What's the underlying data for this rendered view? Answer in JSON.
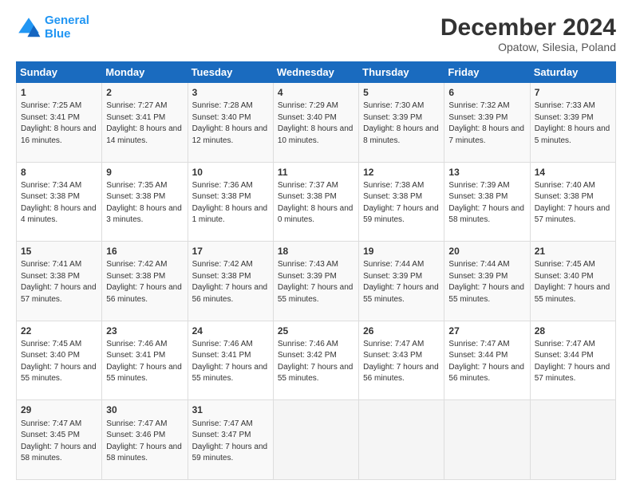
{
  "header": {
    "logo_line1": "General",
    "logo_line2": "Blue",
    "title": "December 2024",
    "subtitle": "Opatow, Silesia, Poland"
  },
  "weekdays": [
    "Sunday",
    "Monday",
    "Tuesday",
    "Wednesday",
    "Thursday",
    "Friday",
    "Saturday"
  ],
  "weeks": [
    [
      {
        "day": "1",
        "sunrise": "7:25 AM",
        "sunset": "3:41 PM",
        "daylight": "8 hours and 16 minutes."
      },
      {
        "day": "2",
        "sunrise": "7:27 AM",
        "sunset": "3:41 PM",
        "daylight": "8 hours and 14 minutes."
      },
      {
        "day": "3",
        "sunrise": "7:28 AM",
        "sunset": "3:40 PM",
        "daylight": "8 hours and 12 minutes."
      },
      {
        "day": "4",
        "sunrise": "7:29 AM",
        "sunset": "3:40 PM",
        "daylight": "8 hours and 10 minutes."
      },
      {
        "day": "5",
        "sunrise": "7:30 AM",
        "sunset": "3:39 PM",
        "daylight": "8 hours and 8 minutes."
      },
      {
        "day": "6",
        "sunrise": "7:32 AM",
        "sunset": "3:39 PM",
        "daylight": "8 hours and 7 minutes."
      },
      {
        "day": "7",
        "sunrise": "7:33 AM",
        "sunset": "3:39 PM",
        "daylight": "8 hours and 5 minutes."
      }
    ],
    [
      {
        "day": "8",
        "sunrise": "7:34 AM",
        "sunset": "3:38 PM",
        "daylight": "8 hours and 4 minutes."
      },
      {
        "day": "9",
        "sunrise": "7:35 AM",
        "sunset": "3:38 PM",
        "daylight": "8 hours and 3 minutes."
      },
      {
        "day": "10",
        "sunrise": "7:36 AM",
        "sunset": "3:38 PM",
        "daylight": "8 hours and 1 minute."
      },
      {
        "day": "11",
        "sunrise": "7:37 AM",
        "sunset": "3:38 PM",
        "daylight": "8 hours and 0 minutes."
      },
      {
        "day": "12",
        "sunrise": "7:38 AM",
        "sunset": "3:38 PM",
        "daylight": "7 hours and 59 minutes."
      },
      {
        "day": "13",
        "sunrise": "7:39 AM",
        "sunset": "3:38 PM",
        "daylight": "7 hours and 58 minutes."
      },
      {
        "day": "14",
        "sunrise": "7:40 AM",
        "sunset": "3:38 PM",
        "daylight": "7 hours and 57 minutes."
      }
    ],
    [
      {
        "day": "15",
        "sunrise": "7:41 AM",
        "sunset": "3:38 PM",
        "daylight": "7 hours and 57 minutes."
      },
      {
        "day": "16",
        "sunrise": "7:42 AM",
        "sunset": "3:38 PM",
        "daylight": "7 hours and 56 minutes."
      },
      {
        "day": "17",
        "sunrise": "7:42 AM",
        "sunset": "3:38 PM",
        "daylight": "7 hours and 56 minutes."
      },
      {
        "day": "18",
        "sunrise": "7:43 AM",
        "sunset": "3:39 PM",
        "daylight": "7 hours and 55 minutes."
      },
      {
        "day": "19",
        "sunrise": "7:44 AM",
        "sunset": "3:39 PM",
        "daylight": "7 hours and 55 minutes."
      },
      {
        "day": "20",
        "sunrise": "7:44 AM",
        "sunset": "3:39 PM",
        "daylight": "7 hours and 55 minutes."
      },
      {
        "day": "21",
        "sunrise": "7:45 AM",
        "sunset": "3:40 PM",
        "daylight": "7 hours and 55 minutes."
      }
    ],
    [
      {
        "day": "22",
        "sunrise": "7:45 AM",
        "sunset": "3:40 PM",
        "daylight": "7 hours and 55 minutes."
      },
      {
        "day": "23",
        "sunrise": "7:46 AM",
        "sunset": "3:41 PM",
        "daylight": "7 hours and 55 minutes."
      },
      {
        "day": "24",
        "sunrise": "7:46 AM",
        "sunset": "3:41 PM",
        "daylight": "7 hours and 55 minutes."
      },
      {
        "day": "25",
        "sunrise": "7:46 AM",
        "sunset": "3:42 PM",
        "daylight": "7 hours and 55 minutes."
      },
      {
        "day": "26",
        "sunrise": "7:47 AM",
        "sunset": "3:43 PM",
        "daylight": "7 hours and 56 minutes."
      },
      {
        "day": "27",
        "sunrise": "7:47 AM",
        "sunset": "3:44 PM",
        "daylight": "7 hours and 56 minutes."
      },
      {
        "day": "28",
        "sunrise": "7:47 AM",
        "sunset": "3:44 PM",
        "daylight": "7 hours and 57 minutes."
      }
    ],
    [
      {
        "day": "29",
        "sunrise": "7:47 AM",
        "sunset": "3:45 PM",
        "daylight": "7 hours and 58 minutes."
      },
      {
        "day": "30",
        "sunrise": "7:47 AM",
        "sunset": "3:46 PM",
        "daylight": "7 hours and 58 minutes."
      },
      {
        "day": "31",
        "sunrise": "7:47 AM",
        "sunset": "3:47 PM",
        "daylight": "7 hours and 59 minutes."
      },
      null,
      null,
      null,
      null
    ]
  ]
}
